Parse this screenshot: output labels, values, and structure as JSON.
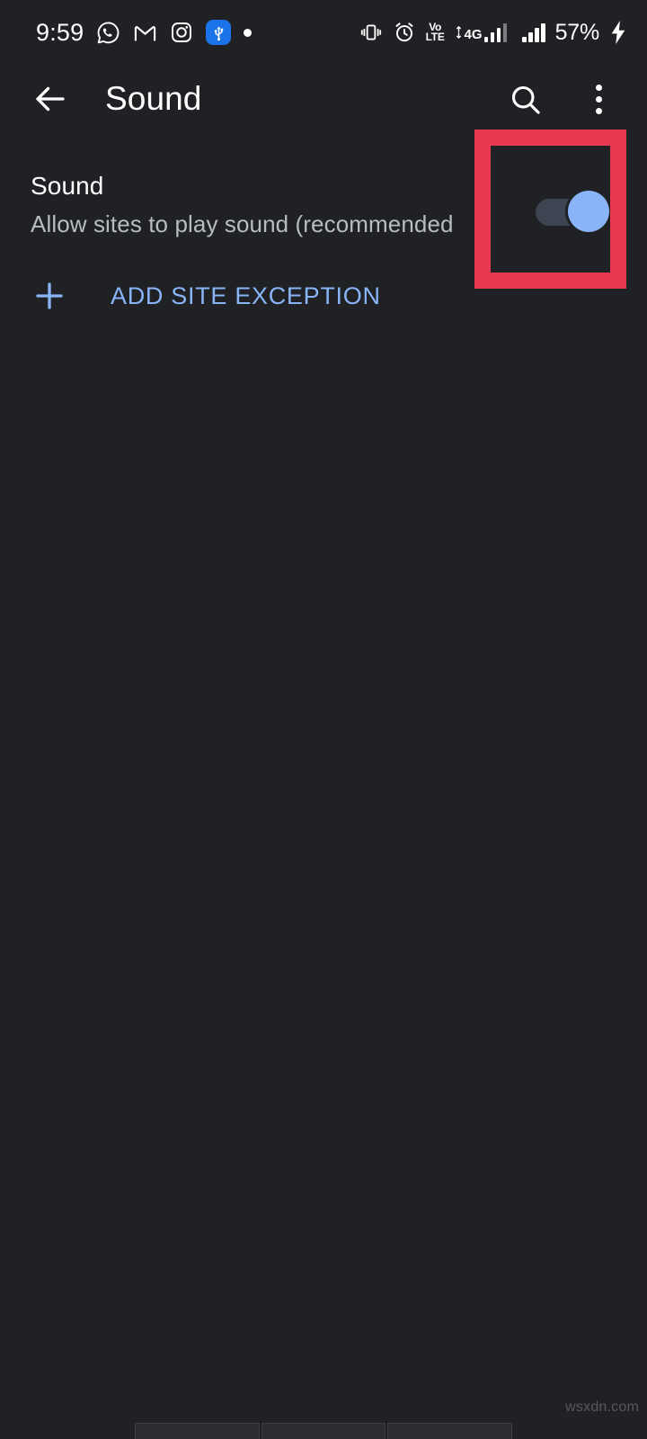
{
  "status_bar": {
    "time": "9:59",
    "left_icons": [
      {
        "name": "whatsapp-icon",
        "label": "WhatsApp"
      },
      {
        "name": "gmail-icon",
        "label": "Gmail"
      },
      {
        "name": "instagram-icon",
        "label": "Instagram"
      },
      {
        "name": "usb-icon",
        "label": "USB connected"
      },
      {
        "name": "notification-dot-icon",
        "label": "More notifications"
      }
    ],
    "right_icons": [
      {
        "name": "vibrate-icon",
        "label": "Vibrate"
      },
      {
        "name": "alarm-icon",
        "label": "Alarm set"
      },
      {
        "name": "volte-icon",
        "label": "VoLTE"
      },
      {
        "name": "signal-sim1-icon",
        "label": "4G signal SIM 1"
      },
      {
        "name": "signal-sim2-icon",
        "label": "Signal SIM 2"
      },
      {
        "name": "charging-bolt-icon",
        "label": "Charging"
      }
    ],
    "volte_top": "Vo",
    "volte_bottom": "LTE",
    "network_type": "4G",
    "battery_percent": "57%"
  },
  "toolbar": {
    "back_label": "Navigate up",
    "title": "Sound",
    "search_label": "Search",
    "overflow_label": "More options"
  },
  "main": {
    "sound_setting": {
      "title": "Sound",
      "summary": "Allow sites to play sound (recommended",
      "toggle_state": "on",
      "toggle_label": "Sound toggle"
    },
    "add_exception": {
      "label": "ADD SITE EXCEPTION",
      "icon": "plus-icon"
    }
  },
  "annotation": {
    "color": "#e8394f",
    "target": "sound-toggle"
  },
  "watermark": {
    "text": "wsxdn.com"
  },
  "colors": {
    "background": "#1f2124",
    "accent_blue": "#8ab4f8",
    "toggle_track": "#3d4552",
    "annotation_red": "#e8394f",
    "primary_text": "#ffffff",
    "secondary_text": "#b9bcbf"
  }
}
